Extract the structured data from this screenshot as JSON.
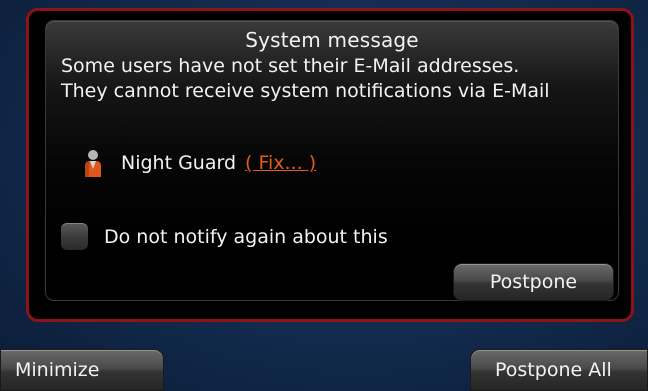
{
  "dialog": {
    "title": "System message",
    "message_line1": "Some users have not set their E-Mail addresses.",
    "message_line2": "They cannot receive system notifications via E-Mail",
    "user": {
      "icon": "user-icon",
      "name": "Night Guard",
      "fix_link": "( Fix... )"
    },
    "checkbox": {
      "label": "Do not notify again about this",
      "checked": false
    },
    "postpone_label": "Postpone"
  },
  "footer": {
    "minimize_label": "Minimize",
    "postpone_all_label": "Postpone All"
  },
  "colors": {
    "frame_border": "#8e1218",
    "link": "#e25a1c",
    "background": "#122a4c"
  }
}
